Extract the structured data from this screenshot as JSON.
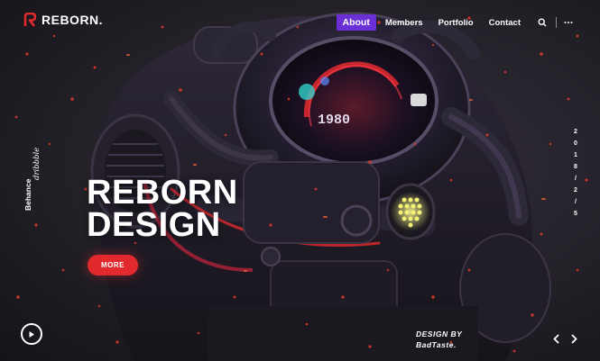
{
  "brand": {
    "name": "REBORN.",
    "accent": "#e22a2e"
  },
  "nav": {
    "items": [
      {
        "label": "About",
        "active": true
      },
      {
        "label": "Members",
        "active": false
      },
      {
        "label": "Portfolio",
        "active": false
      },
      {
        "label": "Contact",
        "active": false
      }
    ],
    "active_color": "#6b2fd6",
    "search_icon": "search-icon",
    "menu_icon": "more-dots-icon"
  },
  "social": {
    "behance": "Behance",
    "dribbble": "dribbble"
  },
  "date": [
    "2",
    "0",
    "1",
    "8",
    "/",
    "2",
    "/",
    "5"
  ],
  "hero": {
    "line1": "REBORN",
    "line2": "DESIGN",
    "button": "MORE"
  },
  "display_counter": "1980",
  "credit": {
    "line1": "DESIGN BY",
    "line2": "BadTaste."
  },
  "controls": {
    "play_icon": "play-icon",
    "prev_icon": "chevron-left-icon",
    "next_icon": "chevron-right-icon"
  }
}
